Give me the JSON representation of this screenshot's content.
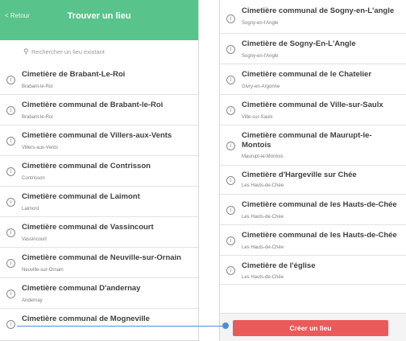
{
  "left": {
    "back_label": "< Retour",
    "title": "Trouver un lieu",
    "search_placeholder": "Rechercher un lieu existant",
    "items": [
      {
        "title": "Cimetière de Brabant-Le-Roi",
        "subtitle": "Brabant-le-Roi"
      },
      {
        "title": "Cimetière communal de Brabant-le-Roi",
        "subtitle": "Brabant-le-Roi"
      },
      {
        "title": "Cimetière communal de Villers-aux-Vents",
        "subtitle": "Villers-aux-Vents"
      },
      {
        "title": "Cimetière communal de Contrisson",
        "subtitle": "Contrisson"
      },
      {
        "title": "Cimetière communal de Laimont",
        "subtitle": "Laimont"
      },
      {
        "title": "Cimetière communal de Vassincourt",
        "subtitle": "Vassincourt"
      },
      {
        "title": "Cimetière communal de Neuville-sur-Ornain",
        "subtitle": "Neuville-sur-Ornain"
      },
      {
        "title": "Cimetière communal D'andernay",
        "subtitle": "Andernay"
      },
      {
        "title": "Cimetière communal de Mogneville",
        "subtitle": ""
      }
    ]
  },
  "right": {
    "items": [
      {
        "title": "Cimetière communal de Sogny-en-L'angle",
        "subtitle": "Sogny-en-l'Angle"
      },
      {
        "title": "Cimetière de Sogny-En-L'Angle",
        "subtitle": "Sogny-en-l'Angle"
      },
      {
        "title": "Cimetière communal de le Chatelier",
        "subtitle": "Givry-en-Argonne"
      },
      {
        "title": "Cimetière communal de Ville-sur-Saulx",
        "subtitle": "Ville-sur-Saulx"
      },
      {
        "title": "Cimetière communal de Maurupt-le-Montois",
        "subtitle": "Maurupt-le-Montois"
      },
      {
        "title": "Cimetière d'Hargeville sur Chée",
        "subtitle": "Les Hauts-de-Chée"
      },
      {
        "title": "Cimetière communal de les Hauts-de-Chée",
        "subtitle": "Les Hauts-de-Chée"
      },
      {
        "title": "Cimetière communal de les Hauts-de-Chée",
        "subtitle": "Les Hauts-de-Chée"
      },
      {
        "title": "Cimetière de l'église",
        "subtitle": "Les Hauts-de-Chée"
      }
    ],
    "create_button": "Créer un lieu"
  },
  "colors": {
    "accent": "#58c38b",
    "create_button": "#ea5a5a",
    "connector": "#4a90d9"
  },
  "icons": {
    "info": "info-circle-icon",
    "search": "search-icon"
  }
}
